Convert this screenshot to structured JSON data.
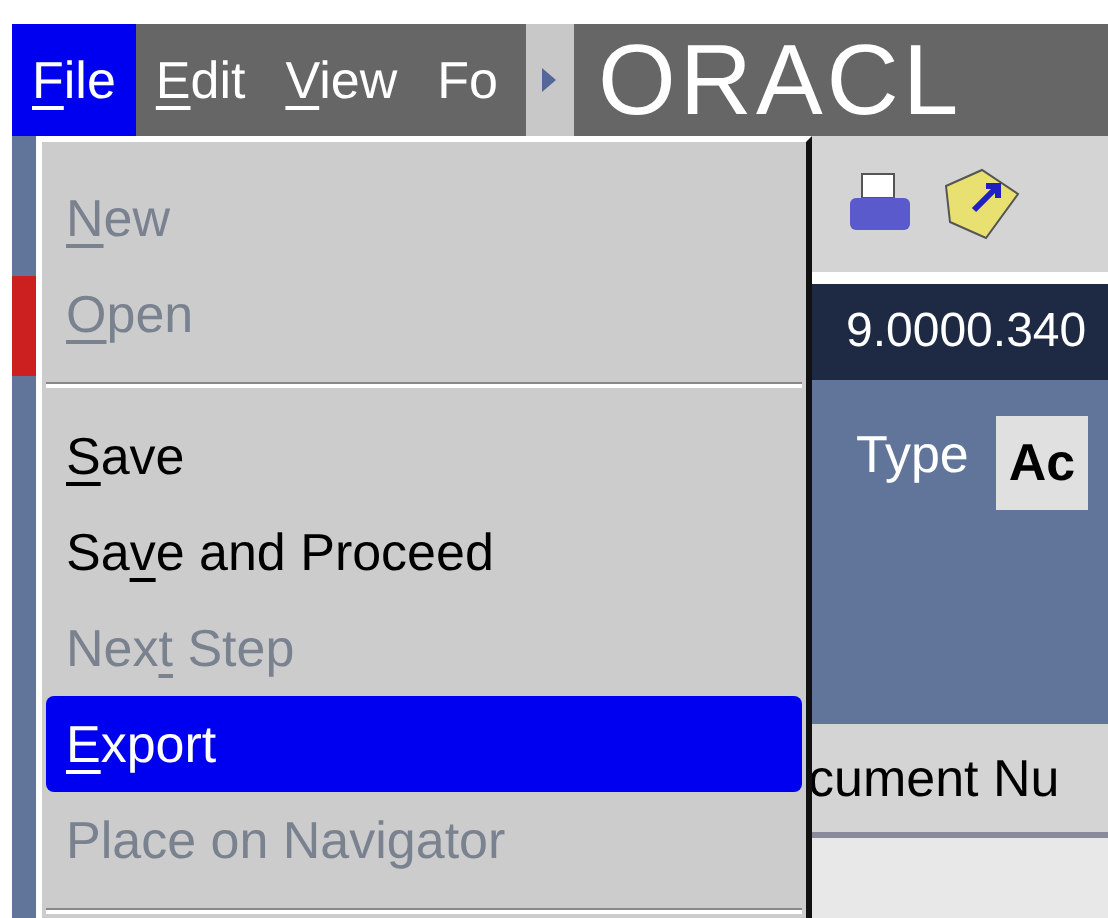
{
  "menu_bar": {
    "items": [
      {
        "key": "F",
        "post": "ile",
        "selected": true
      },
      {
        "key": "E",
        "post": "dit",
        "selected": false
      },
      {
        "key": "V",
        "post": "iew",
        "selected": false
      },
      {
        "pre": "Fo",
        "selected": false
      }
    ],
    "logo": "ORACL"
  },
  "background": {
    "version": "9.0000.340",
    "type_label": "Type",
    "field_value": "Ac",
    "column_label": "cument Nu"
  },
  "file_menu": [
    {
      "kind": "item",
      "key": "N",
      "post": "ew",
      "disabled": true,
      "selected": false
    },
    {
      "kind": "item",
      "key": "O",
      "post": "pen",
      "disabled": true,
      "selected": false
    },
    {
      "kind": "separator"
    },
    {
      "kind": "item",
      "key": "S",
      "post": "ave",
      "disabled": false,
      "selected": false
    },
    {
      "kind": "item",
      "pre": "Sa",
      "key": "v",
      "post": "e and Proceed",
      "disabled": false,
      "selected": false
    },
    {
      "kind": "item",
      "pre": "Nex",
      "key": "t",
      "post": " Step",
      "disabled": true,
      "selected": false
    },
    {
      "kind": "item",
      "key": "E",
      "post": "xport",
      "disabled": false,
      "selected": true
    },
    {
      "kind": "item",
      "pre": "Place on Navigator",
      "disabled": true,
      "selected": false
    },
    {
      "kind": "separator"
    }
  ]
}
